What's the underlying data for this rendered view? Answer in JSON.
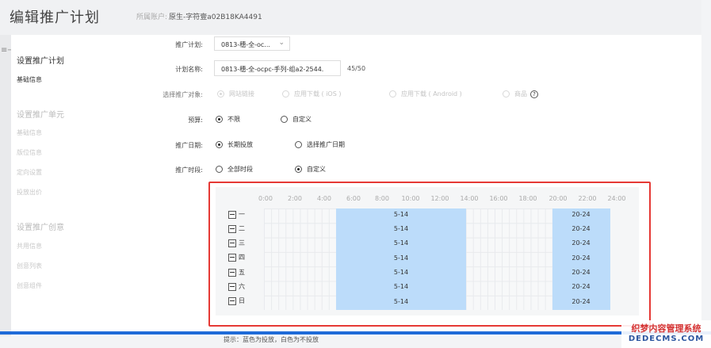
{
  "header": {
    "title": "编辑推广计划",
    "account_label": "所属账户:",
    "account_value": "原生-字符壹a02B18KA4491"
  },
  "sidebar": {
    "menu_icon": "menu-collapse-icon",
    "sections": [
      {
        "title": "设置推广计划",
        "active": true,
        "items": [
          {
            "label": "基础信息",
            "active": true
          }
        ]
      },
      {
        "title": "设置推广单元",
        "active": false,
        "items": [
          {
            "label": "基础信息"
          },
          {
            "label": "版位信息"
          },
          {
            "label": "定向设置"
          },
          {
            "label": "投放出价"
          }
        ]
      },
      {
        "title": "设置推广创意",
        "active": false,
        "items": [
          {
            "label": "共用信息"
          },
          {
            "label": "创意列表"
          },
          {
            "label": "创意组件"
          }
        ]
      }
    ]
  },
  "form": {
    "plan": {
      "label": "推广计划:",
      "value": "0813-穗-全-oc..."
    },
    "plan_name": {
      "label": "计划名称:",
      "value": "0813-穗-全-ocpc-手列-组a2-2544.",
      "counter": "45/50"
    },
    "target": {
      "label": "选择推广对象:",
      "options": [
        "网站链接",
        "应用下载 ( iOS )",
        "应用下载 ( Android )",
        "商品"
      ],
      "selected": "网站链接"
    },
    "budget": {
      "label": "预算:",
      "options": [
        "不限",
        "自定义"
      ],
      "selected": "不限"
    },
    "date": {
      "label": "推广日期:",
      "options": [
        "长期投放",
        "选择推广日期"
      ],
      "selected": "长期投放"
    },
    "period": {
      "label": "推广时段:",
      "options": [
        "全部时段",
        "自定义"
      ],
      "selected": "自定义"
    }
  },
  "schedule": {
    "hours": [
      "0:00",
      "2:00",
      "4:00",
      "6:00",
      "8:00",
      "10:00",
      "12:00",
      "14:00",
      "16:00",
      "18:00",
      "20:00",
      "22:00",
      "24:00"
    ],
    "days": [
      "一",
      "二",
      "三",
      "四",
      "五",
      "六",
      "日"
    ],
    "block1_label": "5-14",
    "block2_label": "20-24",
    "colors": {
      "selected": "#bcdcfa",
      "highlight_border": "#e53935"
    }
  },
  "hint": "提示：蓝色为投放，白色为不投放",
  "watermark": {
    "line1": "织梦内容管理系统",
    "line2": "DEDECMS.COM"
  }
}
